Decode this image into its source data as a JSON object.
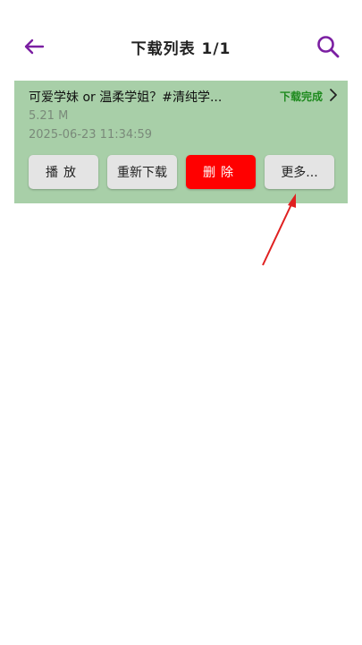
{
  "header": {
    "title": "下载列表 1/1",
    "back_icon": "arrow-left-icon",
    "search_icon": "search-icon"
  },
  "colors": {
    "accent": "#7b1fa2",
    "card_bg": "#a8cfa8",
    "status": "#1e8a1e",
    "delete": "#ff0000"
  },
  "download_item": {
    "title": "可爱学妹 or 温柔学姐？#清纯学...",
    "status": "下载完成",
    "size": "5.21 M",
    "time": "2025-06-23 11:34:59",
    "actions": {
      "play": "播放",
      "redownload": "重新下载",
      "delete": "删除",
      "more": "更多..."
    }
  }
}
